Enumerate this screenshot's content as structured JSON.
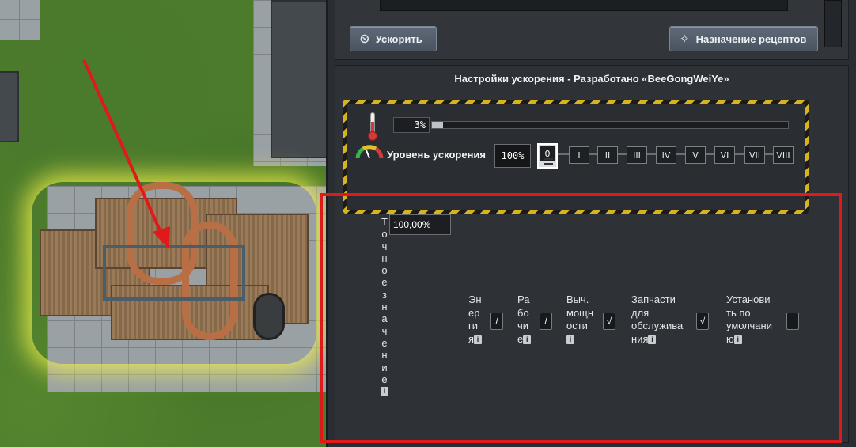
{
  "toolbar": {
    "boost_label": "Ускорить",
    "recipes_label": "Назначение рецептов"
  },
  "settings": {
    "title": "Настройки ускорения - Разработано «BeeGongWeiYe»",
    "slider_percent": "3%",
    "slider_value": 0.03,
    "level_label": "Уровень ускорения",
    "level_percent": "100%",
    "levels": [
      "0",
      "I",
      "II",
      "III",
      "IV",
      "V",
      "VI",
      "VII",
      "VIII"
    ],
    "active_level": "0",
    "exact_label": "Точное значение",
    "exact_value": "100,00%",
    "info_glyph": "i",
    "options": [
      {
        "line1": "Эн",
        "line2": "ер",
        "line3": "ги",
        "line4": "я",
        "checked": false,
        "mark": "/"
      },
      {
        "line1": "Ра",
        "line2": "бо",
        "line3": "чи",
        "line4": "е",
        "checked": false,
        "mark": "/"
      },
      {
        "line1": "Выч.",
        "line2": "мощн",
        "line3": "ости",
        "line4": "",
        "checked": true,
        "mark": "√"
      },
      {
        "line1": "Запчасти",
        "line2": "для",
        "line3": "обслужива",
        "line4": "ния",
        "checked": true,
        "mark": "√"
      },
      {
        "line1": "Установи",
        "line2": "ть по",
        "line3": "умолчани",
        "line4": "ю",
        "checked": false,
        "mark": ""
      }
    ]
  },
  "colors": {
    "highlight_red": "#e01a1a",
    "hazard_yellow": "#d6b421",
    "machine_glow": "#f2f24a"
  },
  "icons": {
    "boost": "stopwatch-icon",
    "recipes": "wand-icon",
    "temperature": "thermometer-icon",
    "level": "gauge-icon"
  }
}
